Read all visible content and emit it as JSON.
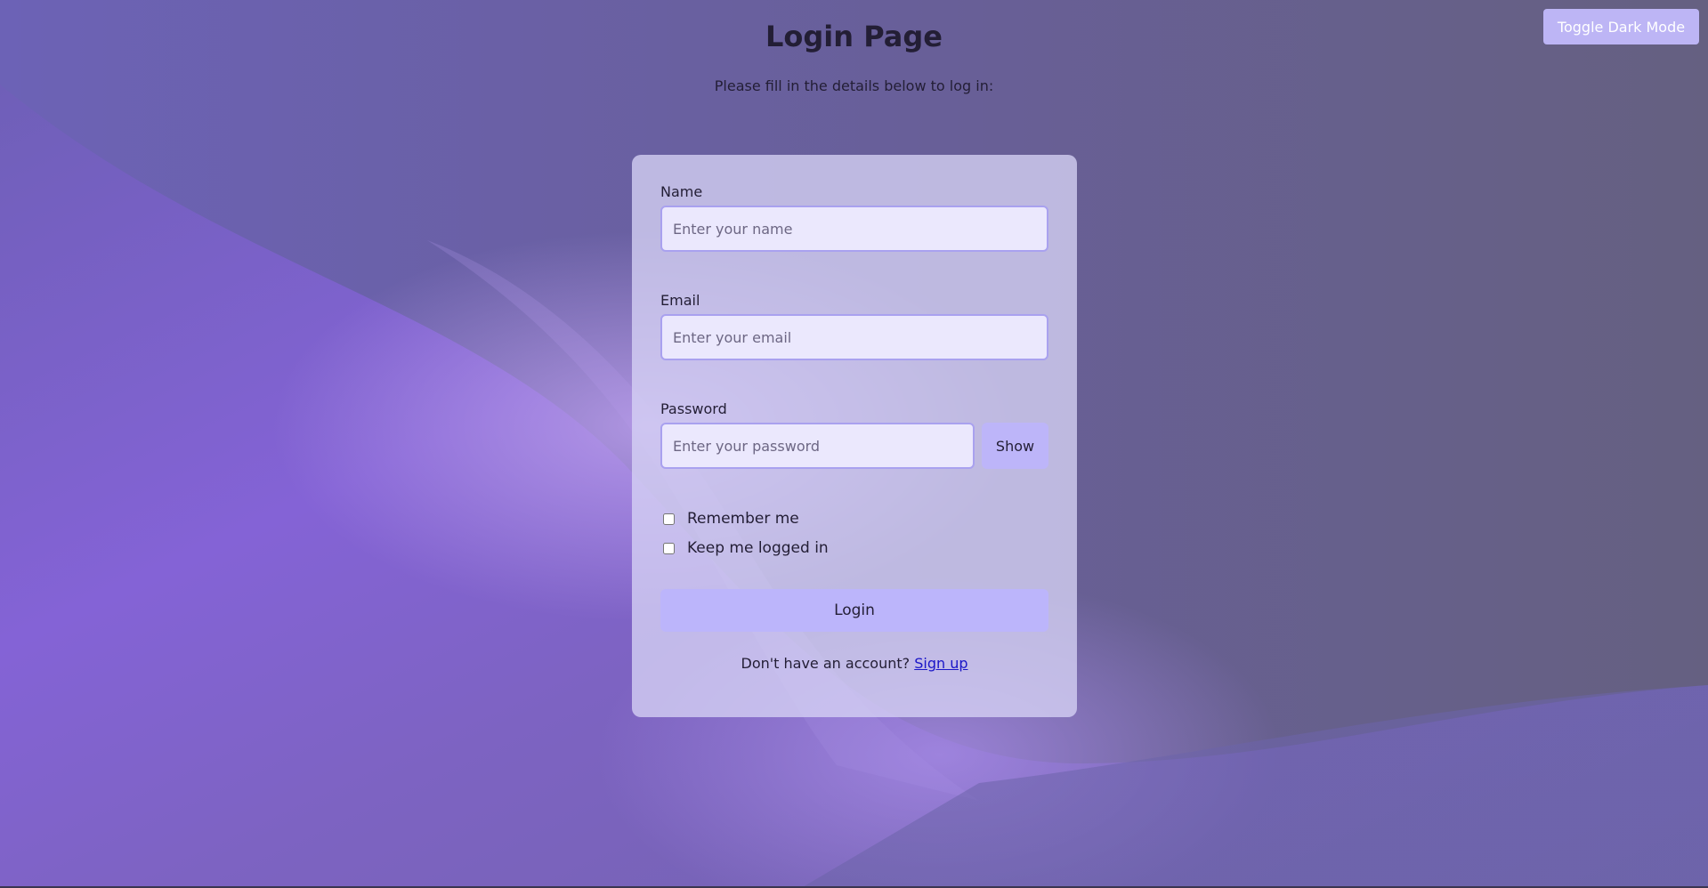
{
  "header": {
    "title": "Login Page",
    "subtitle": "Please fill in the details below to log in:"
  },
  "toggle": {
    "label": "Toggle Dark Mode"
  },
  "form": {
    "name": {
      "label": "Name",
      "placeholder": "Enter your name",
      "value": ""
    },
    "email": {
      "label": "Email",
      "placeholder": "Enter your email",
      "value": ""
    },
    "password": {
      "label": "Password",
      "placeholder": "Enter your password",
      "value": "",
      "show_label": "Show"
    },
    "remember": {
      "label": "Remember me",
      "checked": false
    },
    "keep_logged": {
      "label": "Keep me logged in",
      "checked": false
    },
    "submit_label": "Login",
    "signup_prompt": "Don't have an account?",
    "signup_link": "Sign up"
  },
  "colors": {
    "background": "#676189",
    "wave_light": "#a48ae0",
    "wave_accent": "#8463d6",
    "card": "#d6d2f5",
    "input_bg": "#ebe8fd",
    "input_border": "#a9a1ef",
    "button": "#bcb5fb",
    "toggle_button": "#bdb5f5",
    "link": "#1a16c8"
  }
}
